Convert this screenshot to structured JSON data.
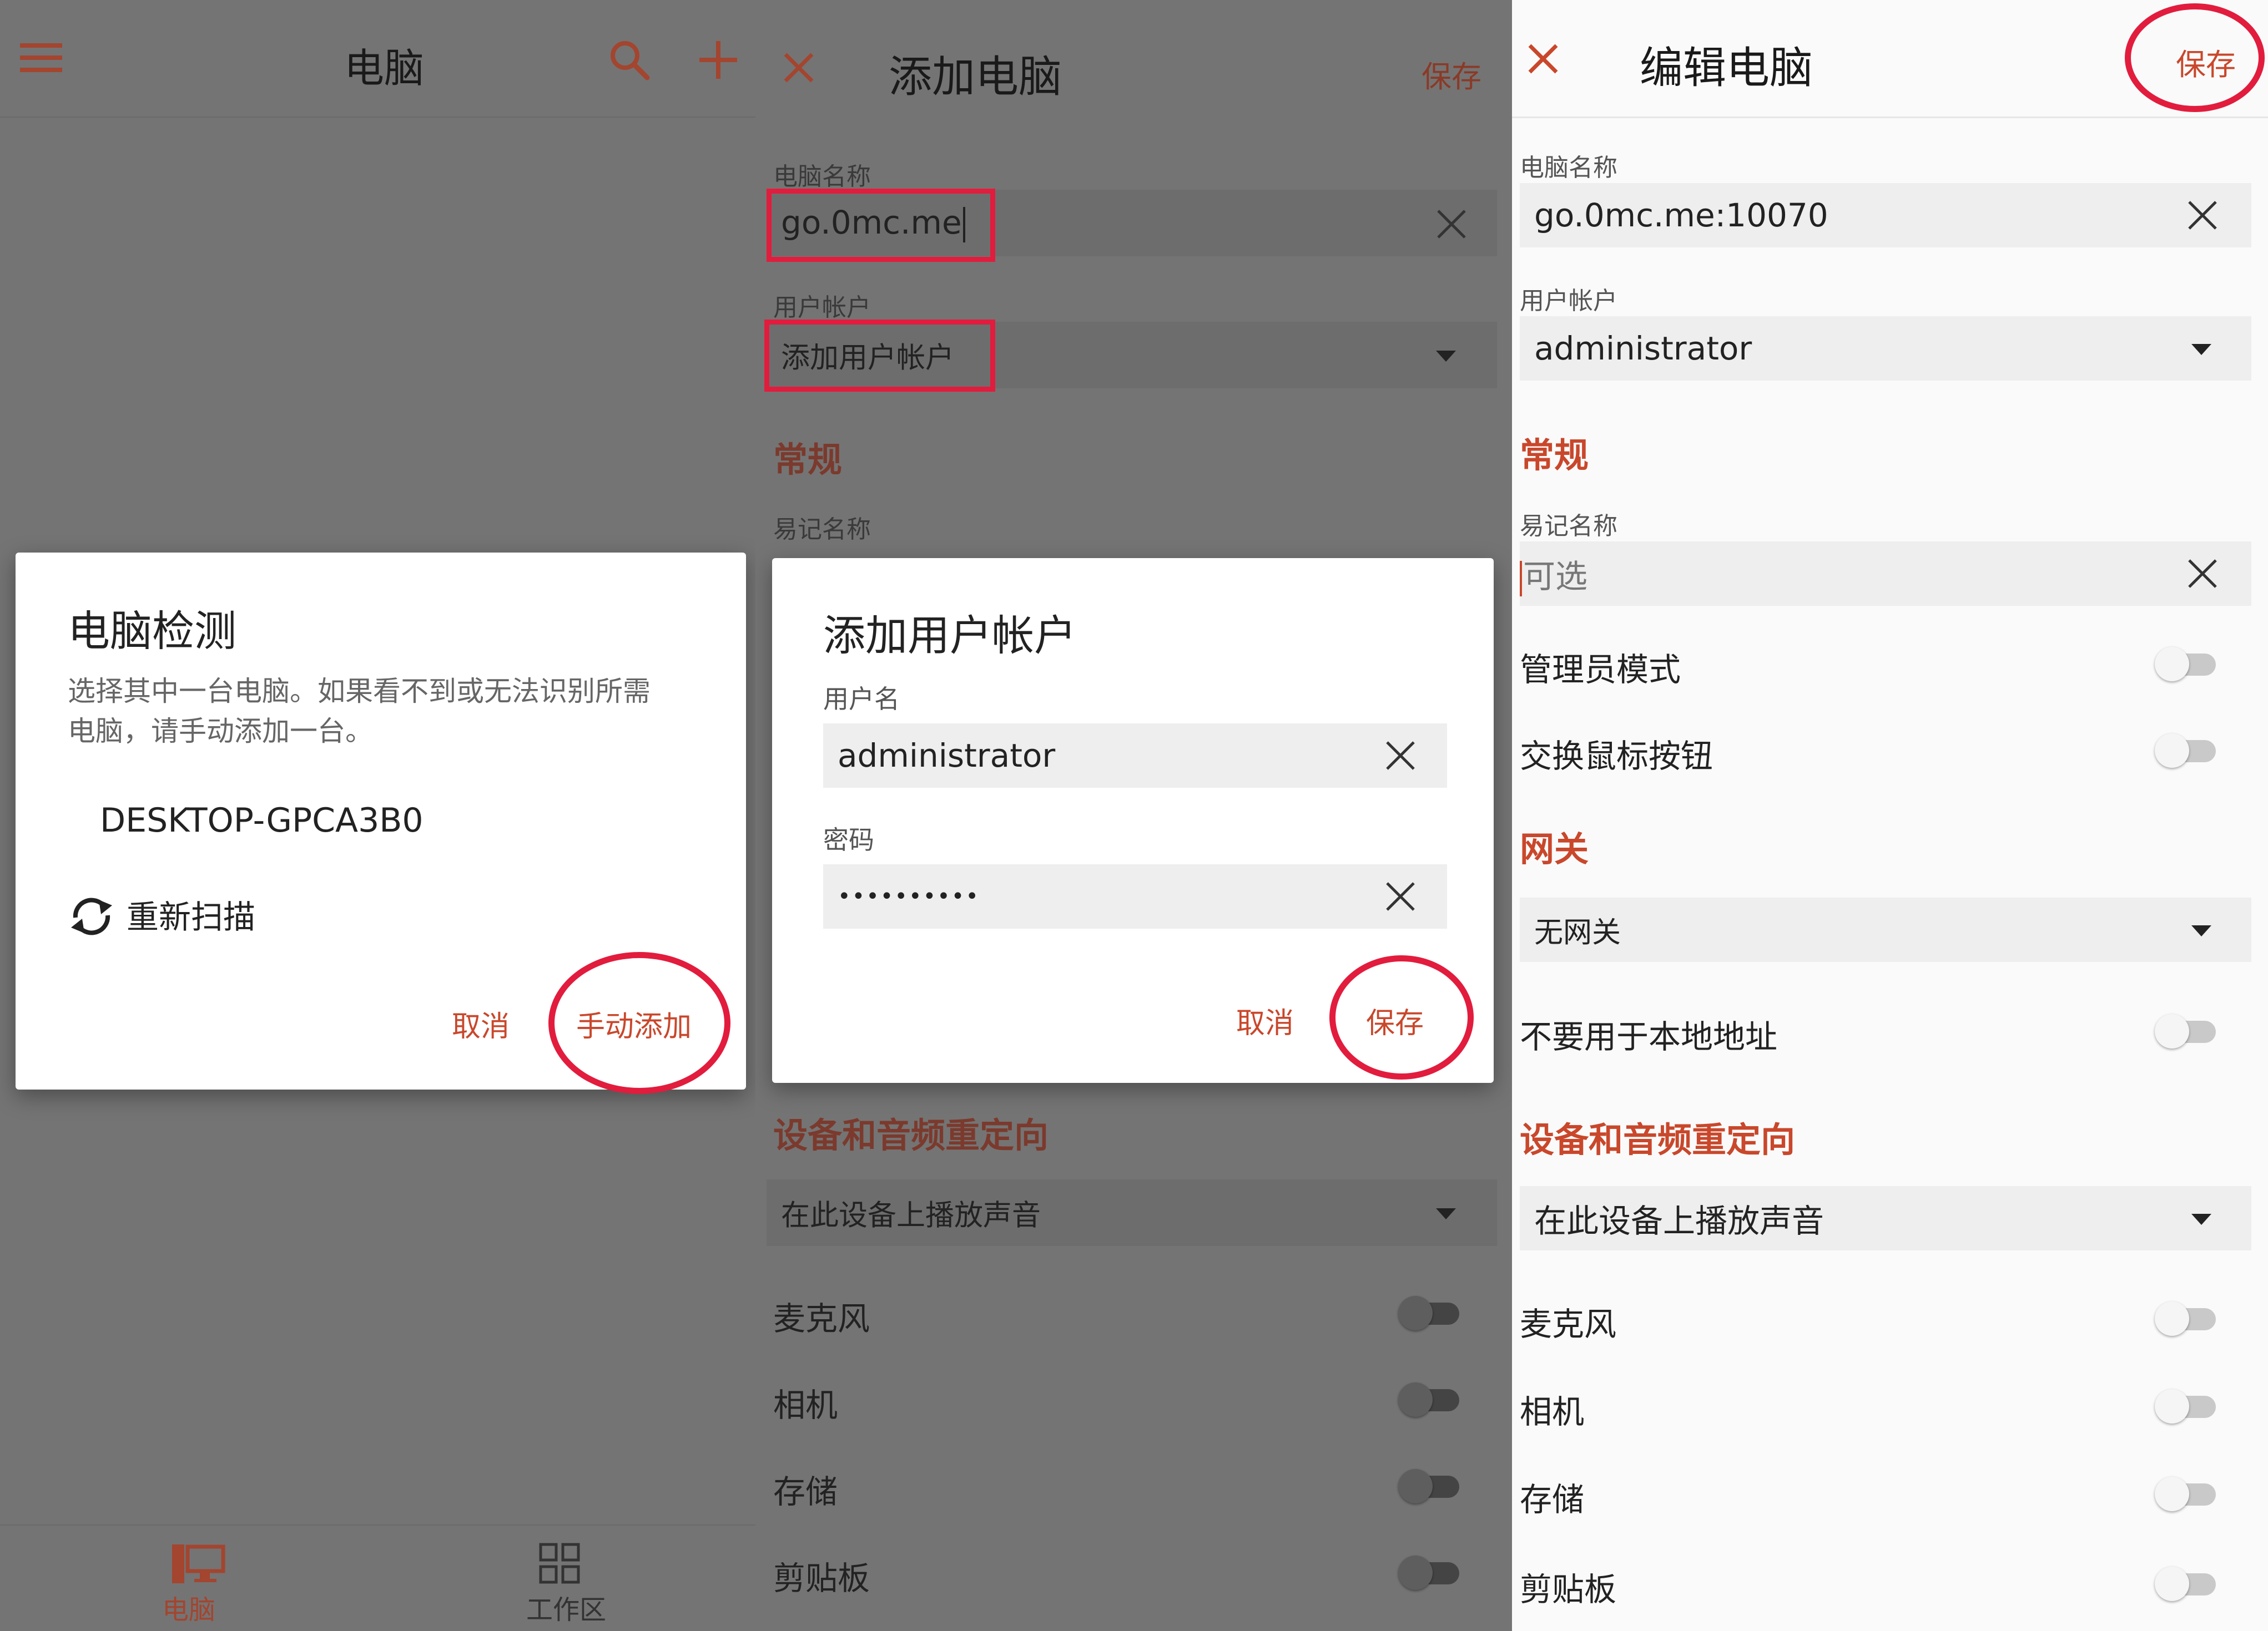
{
  "computers_screen": {
    "title": "电脑",
    "detect_dialog": {
      "title": "电脑检测",
      "message_line1": "选择其中一台电脑。如果看不到或无法识别所需",
      "message_line2": "电脑，请手动添加一台。",
      "device": "DESKTOP-GPCA3B0",
      "rescan": "重新扫描",
      "cancel": "取消",
      "manual_add": "手动添加"
    },
    "bottom_nav": [
      {
        "label": "电脑",
        "icon": "computer-icon",
        "active": true
      },
      {
        "label": "工作区",
        "icon": "workspace-icon",
        "active": false
      }
    ]
  },
  "add_pc_screen": {
    "title": "添加电脑",
    "save": "保存",
    "pc_name_label": "电脑名称",
    "pc_name_value": "go.0mc.me",
    "user_account_label": "用户帐户",
    "user_account_value": "添加用户帐户",
    "general_section": "常规",
    "friendly_name_label": "易记名称",
    "account_dialog": {
      "title": "添加用户帐户",
      "username_label": "用户名",
      "username_value": "administrator",
      "password_label": "密码",
      "password_value": "••••••••••",
      "cancel": "取消",
      "save": "保存"
    },
    "redirection_section": "设备和音频重定向",
    "sound_value": "在此设备上播放声音",
    "toggles": [
      {
        "label": "麦克风",
        "on": false
      },
      {
        "label": "相机",
        "on": false
      },
      {
        "label": "存储",
        "on": false
      },
      {
        "label": "剪贴板",
        "on": false
      }
    ]
  },
  "edit_pc_screen": {
    "title": "编辑电脑",
    "save": "保存",
    "pc_name_label": "电脑名称",
    "pc_name_value": "go.0mc.me:10070",
    "user_account_label": "用户帐户",
    "user_account_value": "administrator",
    "general_section": "常规",
    "friendly_name_label": "易记名称",
    "friendly_name_placeholder": "可选",
    "admin_mode": "管理员模式",
    "swap_mouse": "交换鼠标按钮",
    "gateway_section": "网关",
    "gateway_value": "无网关",
    "bypass_local": "不要用于本地地址",
    "redirection_section": "设备和音频重定向",
    "sound_value": "在此设备上播放声音",
    "toggles": [
      {
        "label": "麦克风",
        "on": false
      },
      {
        "label": "相机",
        "on": false
      },
      {
        "label": "存储",
        "on": false
      },
      {
        "label": "剪贴板",
        "on": false
      }
    ]
  },
  "colors": {
    "accent": "#c9472b",
    "highlight": "#e21c3d",
    "dim_overlay": "#747474"
  }
}
